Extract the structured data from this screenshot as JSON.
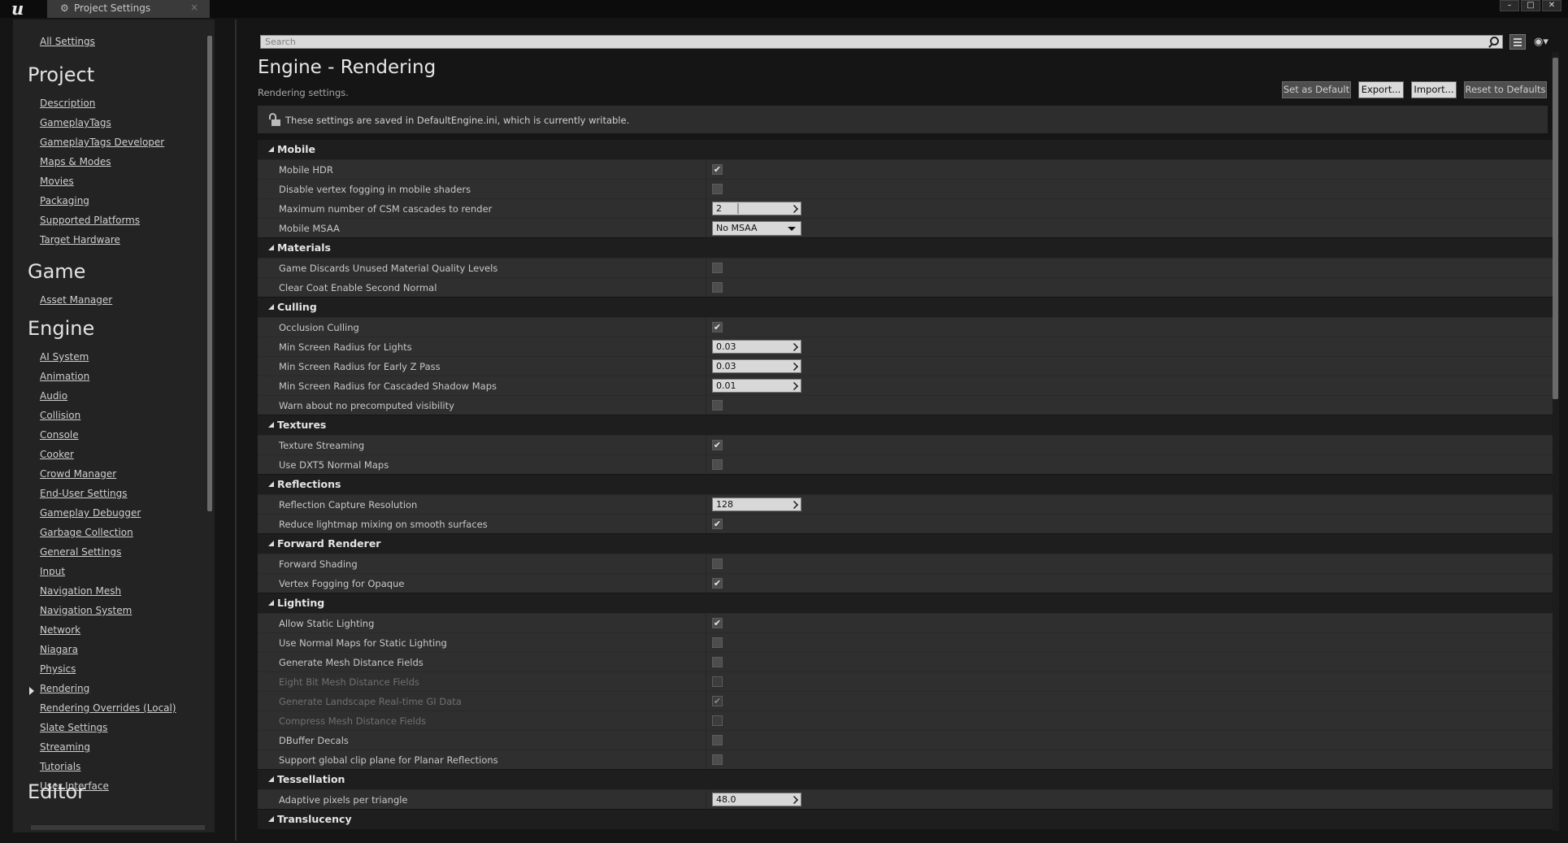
{
  "window": {
    "tab_title": "Project Settings",
    "tab_close": "×",
    "buttons": {
      "minimize": "–",
      "maximize": "□",
      "close": "✕"
    }
  },
  "sidebar": {
    "all_settings": "All Settings",
    "sections": [
      {
        "title": "Project",
        "items": [
          "Description",
          "GameplayTags",
          "GameplayTags Developer",
          "Maps & Modes",
          "Movies",
          "Packaging",
          "Supported Platforms",
          "Target Hardware"
        ]
      },
      {
        "title": "Game",
        "items": [
          "Asset Manager"
        ]
      },
      {
        "title": "Engine",
        "items": [
          "AI System",
          "Animation",
          "Audio",
          "Collision",
          "Console",
          "Cooker",
          "Crowd Manager",
          "End-User Settings",
          "Gameplay Debugger",
          "Garbage Collection",
          "General Settings",
          "Input",
          "Navigation Mesh",
          "Navigation System",
          "Network",
          "Niagara",
          "Physics",
          "Rendering",
          "Rendering Overrides (Local)",
          "Slate Settings",
          "Streaming",
          "Tutorials",
          "User Interface"
        ]
      },
      {
        "title": "Editor",
        "items": []
      }
    ],
    "selected_item": "Rendering"
  },
  "search": {
    "placeholder": "Search"
  },
  "header": {
    "title": "Engine - Rendering",
    "subtitle": "Rendering settings.",
    "buttons": {
      "set_default": "Set as Default",
      "export": "Export...",
      "import": "Import...",
      "reset": "Reset to Defaults"
    },
    "notice": "These settings are saved in DefaultEngine.ini, which is currently writable."
  },
  "categories": [
    {
      "name": "Mobile",
      "rows": [
        {
          "label": "Mobile HDR",
          "type": "check",
          "checked": true
        },
        {
          "label": "Disable vertex fogging in mobile shaders",
          "type": "check",
          "checked": false
        },
        {
          "label": "Maximum number of CSM cascades to render",
          "type": "number",
          "value": "2"
        },
        {
          "label": "Mobile MSAA",
          "type": "combo",
          "value": "No MSAA"
        }
      ]
    },
    {
      "name": "Materials",
      "rows": [
        {
          "label": "Game Discards Unused Material Quality Levels",
          "type": "check",
          "checked": false
        },
        {
          "label": "Clear Coat Enable Second Normal",
          "type": "check",
          "checked": false
        }
      ]
    },
    {
      "name": "Culling",
      "rows": [
        {
          "label": "Occlusion Culling",
          "type": "check",
          "checked": true
        },
        {
          "label": "Min Screen Radius for Lights",
          "type": "number",
          "value": "0.03"
        },
        {
          "label": "Min Screen Radius for Early Z Pass",
          "type": "number",
          "value": "0.03"
        },
        {
          "label": "Min Screen Radius for Cascaded Shadow Maps",
          "type": "number",
          "value": "0.01"
        },
        {
          "label": "Warn about no precomputed visibility",
          "type": "check",
          "checked": false
        }
      ]
    },
    {
      "name": "Textures",
      "rows": [
        {
          "label": "Texture Streaming",
          "type": "check",
          "checked": true
        },
        {
          "label": "Use DXT5 Normal Maps",
          "type": "check",
          "checked": false
        }
      ]
    },
    {
      "name": "Reflections",
      "rows": [
        {
          "label": "Reflection Capture Resolution",
          "type": "number",
          "value": "128"
        },
        {
          "label": "Reduce lightmap mixing on smooth surfaces",
          "type": "check",
          "checked": true
        }
      ]
    },
    {
      "name": "Forward Renderer",
      "rows": [
        {
          "label": "Forward Shading",
          "type": "check",
          "checked": false
        },
        {
          "label": "Vertex Fogging for Opaque",
          "type": "check",
          "checked": true
        }
      ]
    },
    {
      "name": "Lighting",
      "rows": [
        {
          "label": "Allow Static Lighting",
          "type": "check",
          "checked": true
        },
        {
          "label": "Use Normal Maps for Static Lighting",
          "type": "check",
          "checked": false
        },
        {
          "label": "Generate Mesh Distance Fields",
          "type": "check",
          "checked": false
        },
        {
          "label": "Eight Bit Mesh Distance Fields",
          "type": "check",
          "checked": false,
          "disabled": true
        },
        {
          "label": "Generate Landscape Real-time GI Data",
          "type": "check",
          "checked": true,
          "disabled": true
        },
        {
          "label": "Compress Mesh Distance Fields",
          "type": "check",
          "checked": false,
          "disabled": true
        },
        {
          "label": "DBuffer Decals",
          "type": "check",
          "checked": false
        },
        {
          "label": "Support global clip plane for Planar Reflections",
          "type": "check",
          "checked": false
        }
      ]
    },
    {
      "name": "Tessellation",
      "rows": [
        {
          "label": "Adaptive pixels per triangle",
          "type": "number",
          "value": "48.0"
        }
      ]
    },
    {
      "name": "Translucency",
      "rows": []
    }
  ],
  "icons": {
    "check_glyph": "✔"
  },
  "colors": {
    "background": "#151515",
    "panel": "#232323",
    "row": "#2f2f2f",
    "category": "#1e1e1e"
  }
}
